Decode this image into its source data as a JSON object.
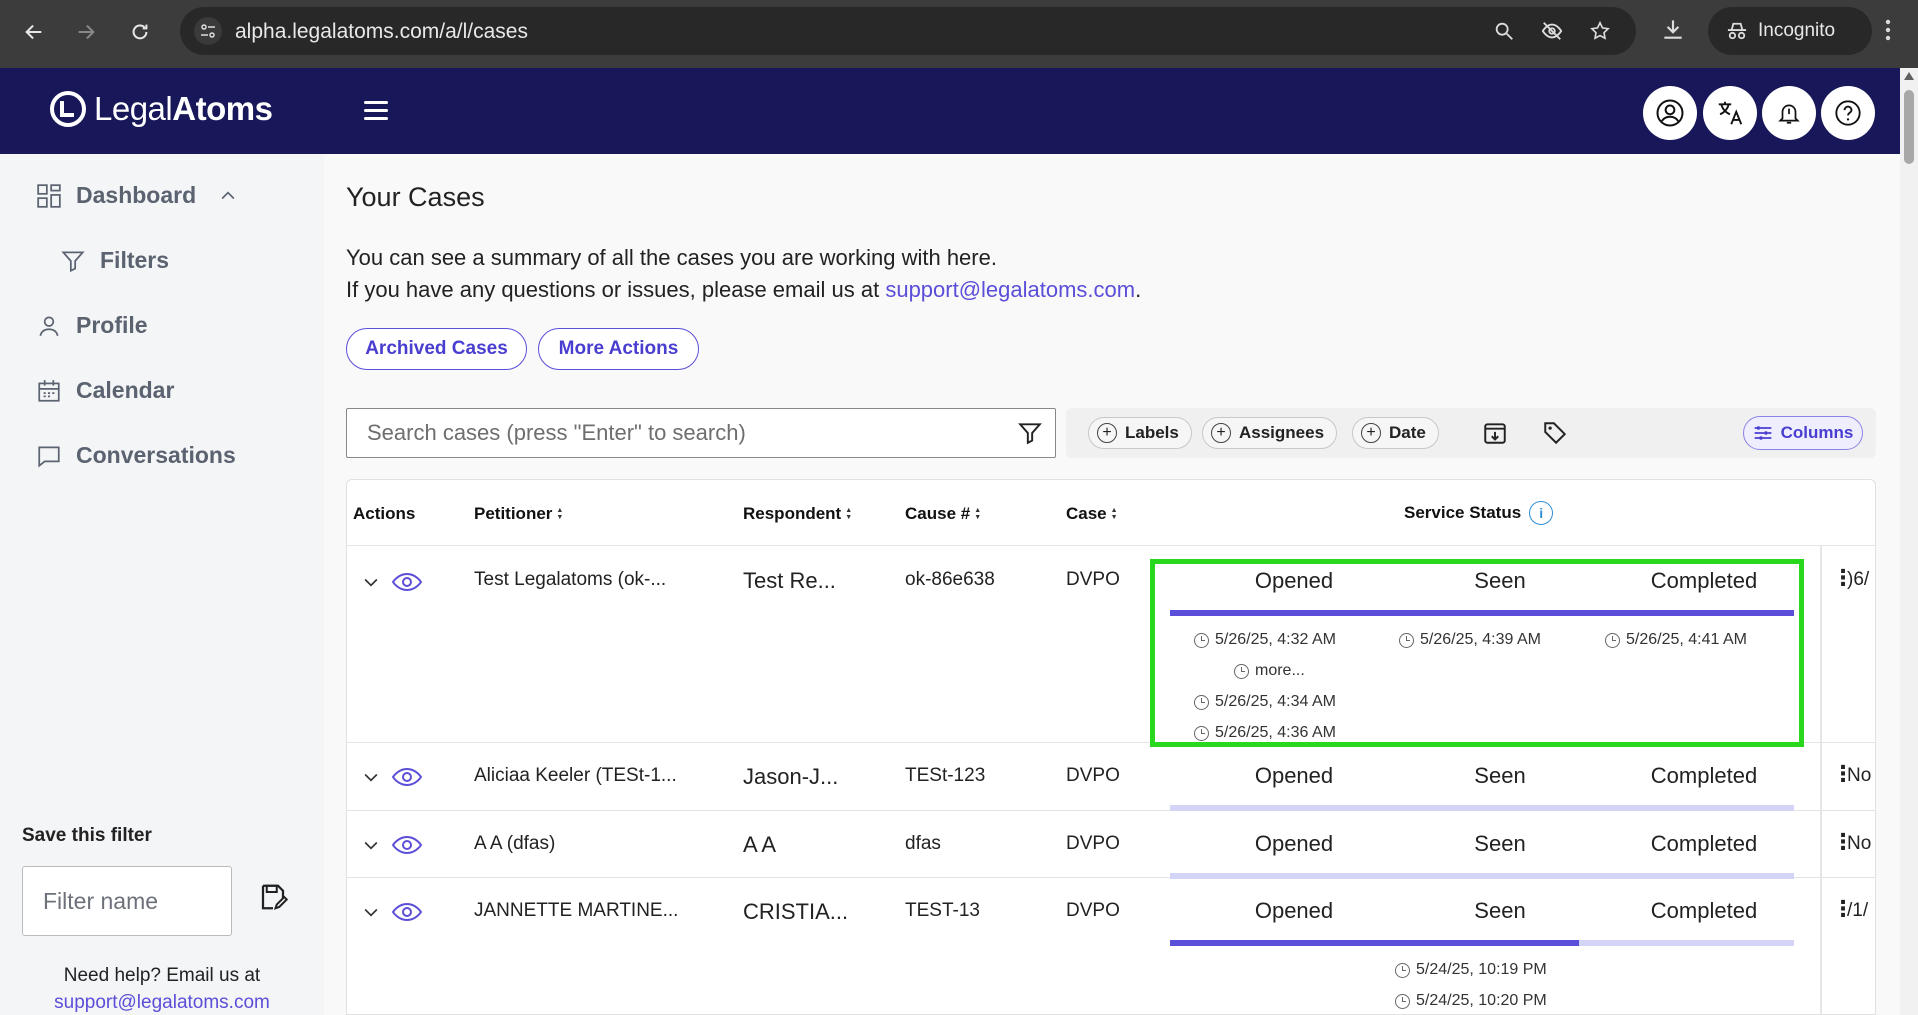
{
  "browser": {
    "url": "alpha.legalatoms.com/a/l/cases",
    "incognito_label": "Incognito"
  },
  "header": {
    "logo_text_light": "Legal",
    "logo_text_bold": "Atoms"
  },
  "sidebar": {
    "items": [
      {
        "label": "Dashboard",
        "icon": "dashboard-icon"
      },
      {
        "label": "Filters",
        "icon": "filter-icon"
      },
      {
        "label": "Profile",
        "icon": "user-icon"
      },
      {
        "label": "Calendar",
        "icon": "calendar-icon"
      },
      {
        "label": "Conversations",
        "icon": "chat-icon"
      }
    ],
    "save_filter_label": "Save this filter",
    "filter_name_placeholder": "Filter name",
    "help_text": "Need help? Email us at",
    "help_email": "support@legalatoms.com"
  },
  "main": {
    "title": "Your Cases",
    "intro_line1": "You can see a summary of all the cases you are working with here.",
    "intro_line2": "If you have any questions or issues, please email us at",
    "support_email": "support@legalatoms.com",
    "period": ".",
    "archived_button": "Archived Cases",
    "more_actions_button": "More Actions",
    "search_placeholder": "Search cases (press \"Enter\" to search)",
    "chips": {
      "labels": "Labels",
      "assignees": "Assignees",
      "date": "Date"
    },
    "columns_button": "Columns"
  },
  "table": {
    "headers": {
      "actions": "Actions",
      "petitioner": "Petitioner",
      "respondent": "Respondent",
      "cause": "Cause #",
      "case": "Case",
      "service_status": "Service Status"
    },
    "status_labels": [
      "Opened",
      "Seen",
      "Completed"
    ],
    "rows": [
      {
        "petitioner": "Test Legalatoms (ok-...",
        "respondent": "Test Re...",
        "cause": "ok-86e638",
        "case": "DVPO",
        "progress": 1.0,
        "opened_times": [
          "5/26/25, 4:32 AM",
          "5/26/25, 4:34 AM",
          "5/26/25, 4:36 AM"
        ],
        "more_label": "more...",
        "seen_times": [
          "5/26/25, 4:39 AM"
        ],
        "completed_times": [
          "5/26/25, 4:41 AM"
        ],
        "trailing": ")6/"
      },
      {
        "petitioner": "Aliciaa Keeler (TESt-1...",
        "respondent": "Jason-J...",
        "cause": "TESt-123",
        "case": "DVPO",
        "progress": 0.0,
        "trailing": "No"
      },
      {
        "petitioner": "A A (dfas)",
        "respondent": "A A",
        "cause": "dfas",
        "case": "DVPO",
        "progress": 0.0,
        "trailing": "No"
      },
      {
        "petitioner": "JANNETTE MARTINE...",
        "respondent": "CRISTIA...",
        "cause": "TEST-13",
        "case": "DVPO",
        "progress": 0.655,
        "seen_times": [
          "5/24/25, 10:19 PM",
          "5/24/25, 10:20 PM"
        ],
        "trailing": "/1/"
      }
    ]
  },
  "colors": {
    "header_bg": "#17175a",
    "accent": "#5b4ed8",
    "highlight": "#27d81c"
  }
}
